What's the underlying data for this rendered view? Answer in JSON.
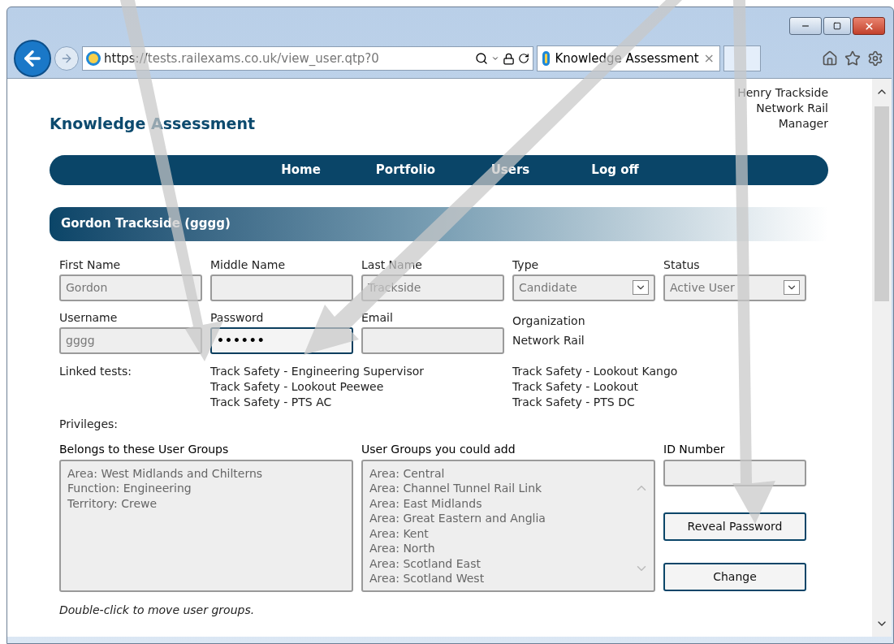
{
  "browser": {
    "url_scheme": "https://",
    "url_host": "tests.railexams.co.uk",
    "url_path": "/view_user.qtp?0",
    "tab": {
      "title": "Knowledge Assessment",
      "close": "×",
      "selected": true
    }
  },
  "header": {
    "title": "Knowledge Assessment",
    "user": [
      "Henry Trackside",
      "Network Rail",
      "Manager"
    ]
  },
  "nav": [
    "Home",
    "Portfolio",
    "Users",
    "Log off"
  ],
  "section_title": "Gordon Trackside (gggg)",
  "fields_row1": [
    {
      "label": "First Name",
      "value": "Gordon",
      "kind": "text",
      "focused": false
    },
    {
      "label": "Middle Name",
      "kind": "text",
      "focused": false
    },
    {
      "label": "Last Name",
      "value": "Trackside",
      "kind": "text",
      "focused": false
    },
    {
      "label": "Type",
      "value": "Candidate",
      "kind": "select",
      "focused": false
    },
    {
      "label": "Status",
      "value": "Active User",
      "kind": "select",
      "focused": false
    }
  ],
  "fields_row2": [
    {
      "label": "Username",
      "value": "gggg",
      "kind": "text",
      "focused": false
    },
    {
      "label": "Password",
      "value": "••••••",
      "kind": "password",
      "focused": true
    },
    {
      "label": "Email",
      "kind": "text",
      "focused": false
    },
    {
      "label": "Organization",
      "value": "Network Rail",
      "kind": "static"
    }
  ],
  "linked_tests": {
    "label": "Linked tests:",
    "column_1": [
      "Track Safety - Engineering Supervisor",
      "Track Safety - Lookout Peewee",
      "Track Safety - PTS AC"
    ],
    "column_2": [
      "Track Safety - Lookout Kango",
      "Track Safety - Lookout",
      "Track Safety - PTS DC"
    ]
  },
  "privileges_label": "Privileges:",
  "belongs": {
    "label": "Belongs to these User Groups",
    "items": [
      "Area: West Midlands and Chilterns",
      "Function: Engineering",
      "Territory: Crewe"
    ]
  },
  "could_add": {
    "label": "User Groups you could add",
    "items": [
      "Area: Central",
      "Area: Channel Tunnel Rail Link",
      "Area: East Midlands",
      "Area: Great Eastern and Anglia",
      "Area: Kent",
      "Area: North",
      "Area: Scotland East",
      "Area: Scotland West"
    ]
  },
  "id_number": {
    "label": "ID Number"
  },
  "buttons": [
    "Reveal Password",
    "Change"
  ],
  "hint": "Double-click to move user groups."
}
